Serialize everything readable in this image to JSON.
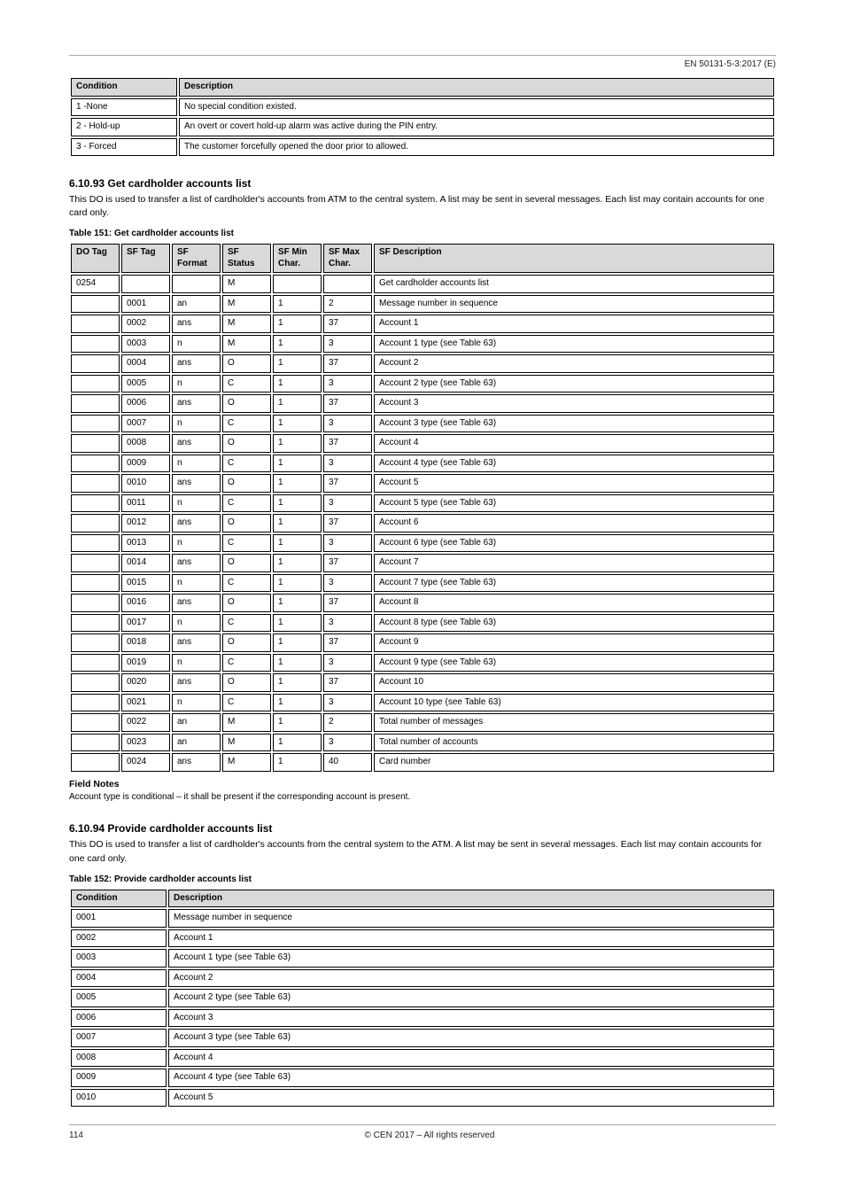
{
  "header": {
    "left": "",
    "right": "EN 50131-5-3:2017 (E)"
  },
  "table150": {
    "headers": [
      "Condition",
      "Description"
    ],
    "rows": [
      [
        "1 -None",
        "No special condition existed."
      ],
      [
        "2 - Hold-up",
        "An overt or covert hold-up alarm was active during the PIN entry."
      ],
      [
        "3 - Forced",
        "The customer forcefully opened the door prior to allowed."
      ]
    ]
  },
  "section_6_10_93": {
    "title": "6.10.93 Get cardholder accounts list",
    "body": "This DO is used to transfer a list of cardholder's accounts from ATM to the central system. A list may be sent in several messages. Each list may contain accounts for one card only."
  },
  "table151": {
    "caption_label": "Table 151: Get cardholder accounts list",
    "headers": [
      "DO Tag",
      "SF Tag",
      "SF Format",
      "SF Status",
      "SF Min Char.",
      "SF Max Char.",
      "SF Description"
    ],
    "rows": [
      [
        "0254",
        "",
        "",
        "M",
        "",
        "",
        "Get cardholder accounts list"
      ],
      [
        "",
        "0001",
        "an",
        "M",
        "1",
        "2",
        "Message number in sequence"
      ],
      [
        "",
        "0002",
        "ans",
        "M",
        "1",
        "37",
        "Account 1"
      ],
      [
        "",
        "0003",
        "n",
        "M",
        "1",
        "3",
        "Account 1 type (see Table 63)"
      ],
      [
        "",
        "0004",
        "ans",
        "O",
        "1",
        "37",
        "Account 2"
      ],
      [
        "",
        "0005",
        "n",
        "C",
        "1",
        "3",
        "Account 2 type (see Table 63)"
      ],
      [
        "",
        "0006",
        "ans",
        "O",
        "1",
        "37",
        "Account 3"
      ],
      [
        "",
        "0007",
        "n",
        "C",
        "1",
        "3",
        "Account 3 type (see Table 63)"
      ],
      [
        "",
        "0008",
        "ans",
        "O",
        "1",
        "37",
        "Account 4"
      ],
      [
        "",
        "0009",
        "n",
        "C",
        "1",
        "3",
        "Account 4 type (see Table 63)"
      ],
      [
        "",
        "0010",
        "ans",
        "O",
        "1",
        "37",
        "Account 5"
      ],
      [
        "",
        "0011",
        "n",
        "C",
        "1",
        "3",
        "Account 5 type (see Table 63)"
      ],
      [
        "",
        "0012",
        "ans",
        "O",
        "1",
        "37",
        "Account 6"
      ],
      [
        "",
        "0013",
        "n",
        "C",
        "1",
        "3",
        "Account 6 type (see Table 63)"
      ],
      [
        "",
        "0014",
        "ans",
        "O",
        "1",
        "37",
        "Account 7"
      ],
      [
        "",
        "0015",
        "n",
        "C",
        "1",
        "3",
        "Account 7 type (see Table 63)"
      ],
      [
        "",
        "0016",
        "ans",
        "O",
        "1",
        "37",
        "Account 8"
      ],
      [
        "",
        "0017",
        "n",
        "C",
        "1",
        "3",
        "Account 8 type (see Table 63)"
      ],
      [
        "",
        "0018",
        "ans",
        "O",
        "1",
        "37",
        "Account 9"
      ],
      [
        "",
        "0019",
        "n",
        "C",
        "1",
        "3",
        "Account 9 type (see Table 63)"
      ],
      [
        "",
        "0020",
        "ans",
        "O",
        "1",
        "37",
        "Account 10"
      ],
      [
        "",
        "0021",
        "n",
        "C",
        "1",
        "3",
        "Account 10 type (see Table 63)"
      ],
      [
        "",
        "0022",
        "an",
        "M",
        "1",
        "2",
        "Total number of messages"
      ],
      [
        "",
        "0023",
        "an",
        "M",
        "1",
        "3",
        "Total number of accounts"
      ],
      [
        "",
        "0024",
        "ans",
        "M",
        "1",
        "40",
        "Card number"
      ]
    ]
  },
  "field_notes": {
    "title": "Field Notes",
    "body": "Account type is conditional – it shall be present if the corresponding account is present."
  },
  "section_6_10_94": {
    "title": "6.10.94 Provide cardholder accounts list",
    "body": "This DO is used to transfer a list of cardholder's accounts from the central system to the ATM. A list may be sent in several messages. Each list may contain accounts for one card only."
  },
  "table152": {
    "caption_label": "Table 152: Provide cardholder accounts list",
    "headers": [
      "Condition",
      "Description"
    ],
    "rows": [
      [
        "0001",
        "Message number in sequence"
      ],
      [
        "0002",
        "Account 1"
      ],
      [
        "0003",
        "Account 1 type (see Table 63)"
      ],
      [
        "0004",
        "Account 2"
      ],
      [
        "0005",
        "Account 2 type (see Table 63)"
      ],
      [
        "0006",
        "Account 3"
      ],
      [
        "0007",
        "Account 3 type (see Table 63)"
      ],
      [
        "0008",
        "Account 4"
      ],
      [
        "0009",
        "Account 4 type (see Table 63)"
      ],
      [
        "0010",
        "Account 5"
      ]
    ]
  },
  "footer": {
    "left": "114",
    "center": "© CEN 2017 – All rights reserved",
    "right": ""
  }
}
